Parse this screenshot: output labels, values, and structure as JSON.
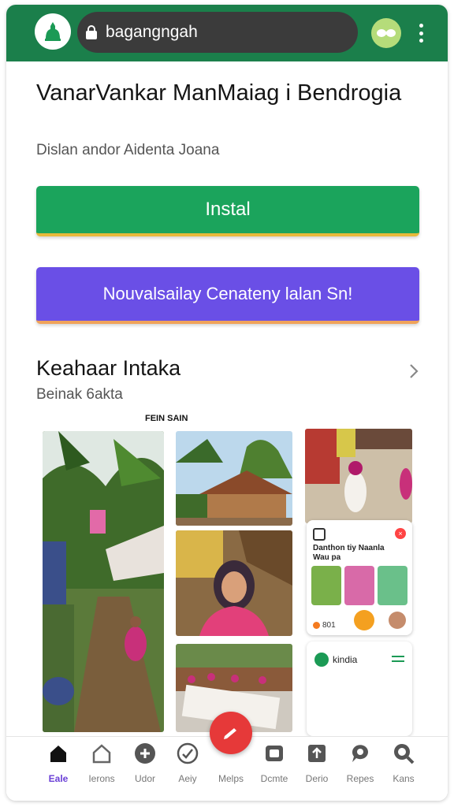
{
  "browser": {
    "url": "bagangngah",
    "icons": [
      "app-logo-icon",
      "lock-icon",
      "extension-icon",
      "more-vert-icon"
    ]
  },
  "app": {
    "title": "VanarVankar ManMaiag  i Bendrogia",
    "subtitle": "Dislan andor Aidenta Joana",
    "install_label": "Instal",
    "secondary_label": "Nouvalsailay Cenateny lalan Sn!"
  },
  "section": {
    "title": "Keahaar Intaka",
    "subtitle": "Beinak 6akta",
    "small_label": "FEIN SAIN"
  },
  "card": {
    "text": "Danthon tiy Naanla Wau pa",
    "count": "801"
  },
  "card2": {
    "label": "kindia"
  },
  "colors": {
    "topbar": "#1b7f4b",
    "install": "#1ba45c",
    "secondary": "#6a4fe6",
    "fab": "#e63939",
    "active_nav": "#6a3fd6"
  },
  "nav": [
    {
      "label": "Eale",
      "icon": "home-icon",
      "active": true
    },
    {
      "label": "Ierons",
      "icon": "house-outline-icon",
      "active": false
    },
    {
      "label": "Udor",
      "icon": "plus-circle-icon",
      "active": false
    },
    {
      "label": "Aeiy",
      "icon": "check-circle-icon",
      "active": false
    },
    {
      "label": "Melps",
      "icon": "edit-icon",
      "active": false
    },
    {
      "label": "Dcmte",
      "icon": "tablet-icon",
      "active": false
    },
    {
      "label": "Derio",
      "icon": "share-box-icon",
      "active": false
    },
    {
      "label": "Repes",
      "icon": "chat-icon",
      "active": false
    },
    {
      "label": "Kans",
      "icon": "search-icon",
      "active": false
    }
  ]
}
